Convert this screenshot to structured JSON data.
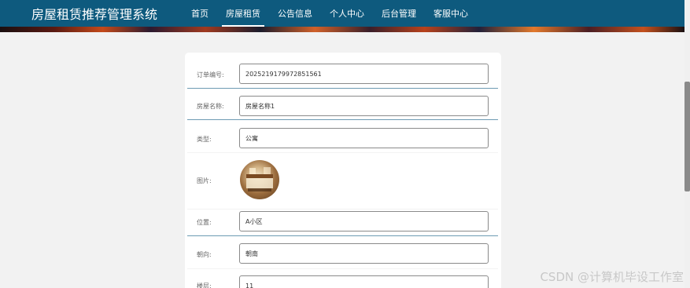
{
  "app": {
    "title": "房屋租赁推荐管理系统"
  },
  "nav": {
    "items": [
      {
        "label": "首页"
      },
      {
        "label": "房屋租赁"
      },
      {
        "label": "公告信息"
      },
      {
        "label": "个人中心"
      },
      {
        "label": "后台管理"
      },
      {
        "label": "客服中心"
      }
    ],
    "active": "房屋租赁"
  },
  "form": {
    "order_no": {
      "label": "订单编号:",
      "value": "2025219179972851561"
    },
    "house_name": {
      "label": "房屋名称:",
      "value": "房屋名称1"
    },
    "type": {
      "label": "类型:",
      "value": "公寓"
    },
    "image": {
      "label": "图片:"
    },
    "location": {
      "label": "位置:",
      "value": "A小区"
    },
    "orientation": {
      "label": "朝向:",
      "value": "朝南"
    },
    "floor": {
      "label": "楼层:",
      "value": "11"
    }
  },
  "watermark": "CSDN @计算机毕设工作室"
}
